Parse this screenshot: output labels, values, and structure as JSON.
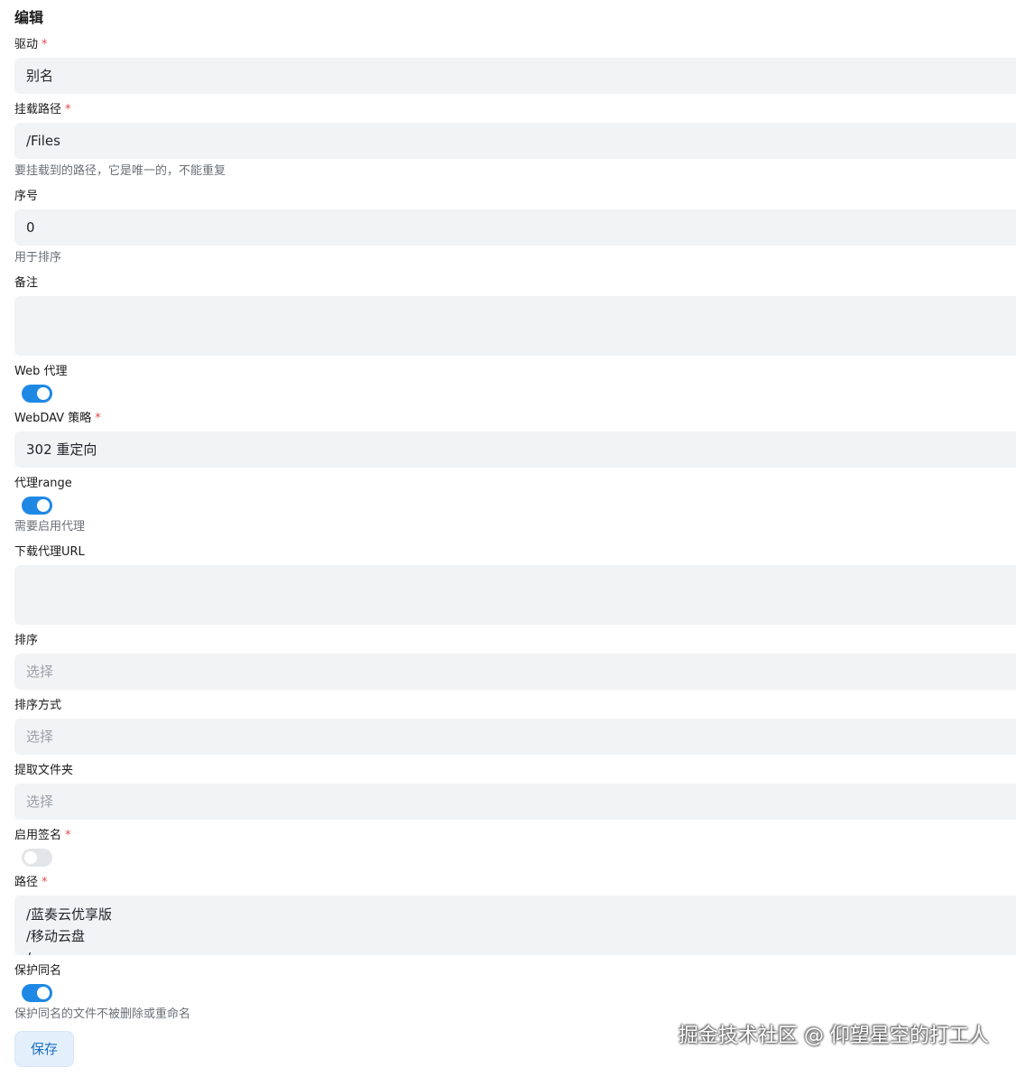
{
  "page": {
    "title": "编辑"
  },
  "required_mark": "*",
  "form": {
    "driver": {
      "label": "驱动",
      "value": "别名"
    },
    "mount_path": {
      "label": "挂载路径",
      "value": "/Files",
      "help": "要挂载到的路径，它是唯一的，不能重复"
    },
    "order": {
      "label": "序号",
      "value": "0",
      "help": "用于排序"
    },
    "remark": {
      "label": "备注",
      "value": ""
    },
    "web_proxy": {
      "label": "Web 代理",
      "enabled": true
    },
    "webdav_policy": {
      "label": "WebDAV 策略",
      "value": "302 重定向"
    },
    "proxy_range": {
      "label": "代理range",
      "enabled": true,
      "help": "需要启用代理"
    },
    "download_proxy_url": {
      "label": "下载代理URL",
      "value": ""
    },
    "sort": {
      "label": "排序",
      "placeholder": "选择"
    },
    "sort_direction": {
      "label": "排序方式",
      "placeholder": "选择"
    },
    "extract_folder": {
      "label": "提取文件夹",
      "placeholder": "选择"
    },
    "enable_sign": {
      "label": "启用签名",
      "enabled": false
    },
    "paths": {
      "label": "路径",
      "lines": [
        "/蓝奏云优享版",
        "/移动云盘",
        "/..."
      ]
    },
    "protect_same_name": {
      "label": "保护同名",
      "enabled": true,
      "help": "保护同名的文件不被删除或重命名"
    }
  },
  "actions": {
    "save_label": "保存"
  },
  "watermark": "掘金技术社区 @ 仰望星空的打工人",
  "colors": {
    "accent": "#1e88e5",
    "field_bg": "#f2f3f5",
    "required": "#e5484d",
    "help_text": "#6b6f76",
    "save_button_bg": "#e3f0fc"
  }
}
